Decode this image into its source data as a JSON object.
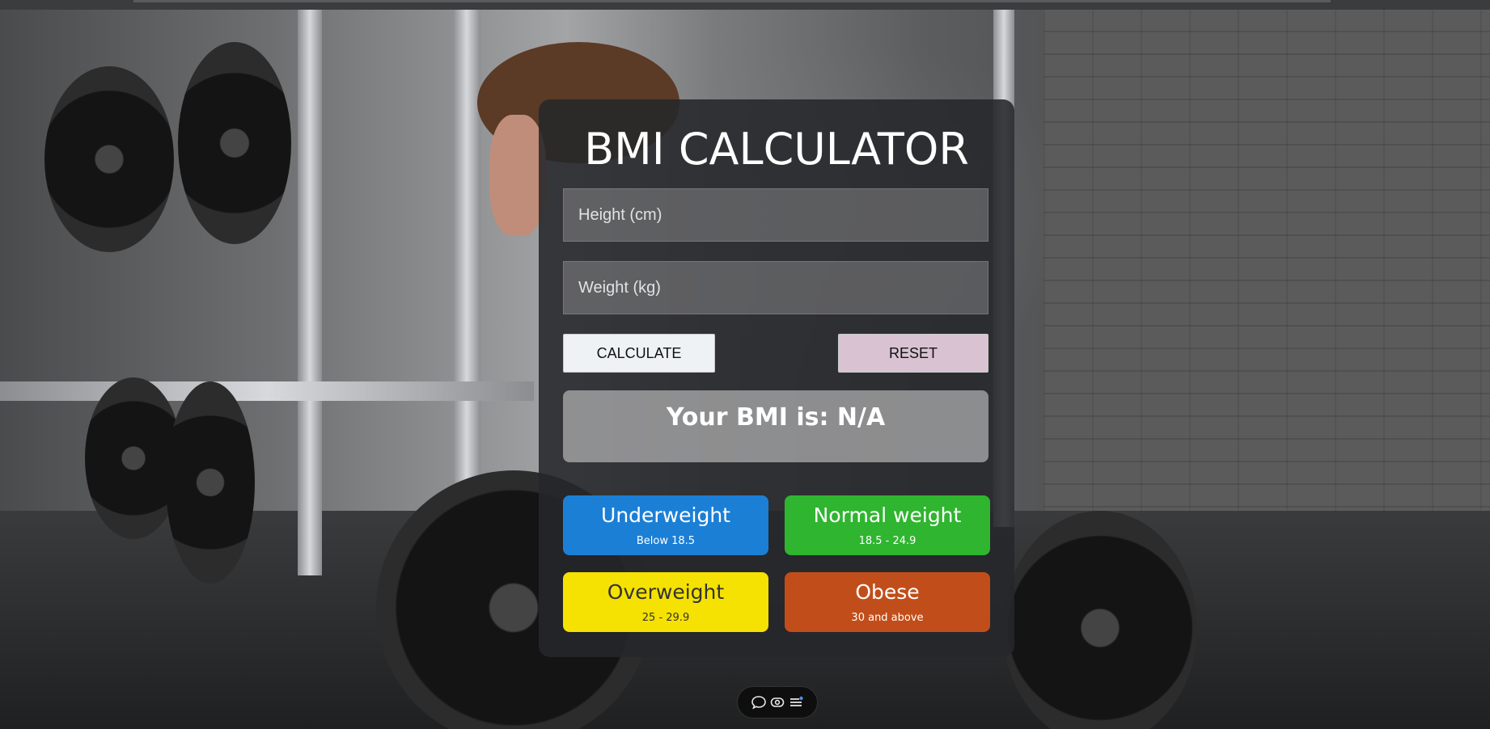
{
  "calculator": {
    "title": "BMI CALCULATOR",
    "height_placeholder": "Height (cm)",
    "weight_placeholder": "Weight (kg)",
    "calculate_label": "CALCULATE",
    "reset_label": "RESET",
    "result_text": "Your BMI is: N/A"
  },
  "categories": [
    {
      "name": "Underweight",
      "range": "Below 18.5",
      "color": "#1c7fd6"
    },
    {
      "name": "Normal weight",
      "range": "18.5 - 24.9",
      "color": "#2fb52f"
    },
    {
      "name": "Overweight",
      "range": "25 - 29.9",
      "color": "#f5e102"
    },
    {
      "name": "Obese",
      "range": "30 and above",
      "color": "#c14e1a"
    }
  ],
  "dock": {
    "icons": [
      "chat-bubble-icon",
      "eye-icon",
      "menu-icon"
    ]
  }
}
